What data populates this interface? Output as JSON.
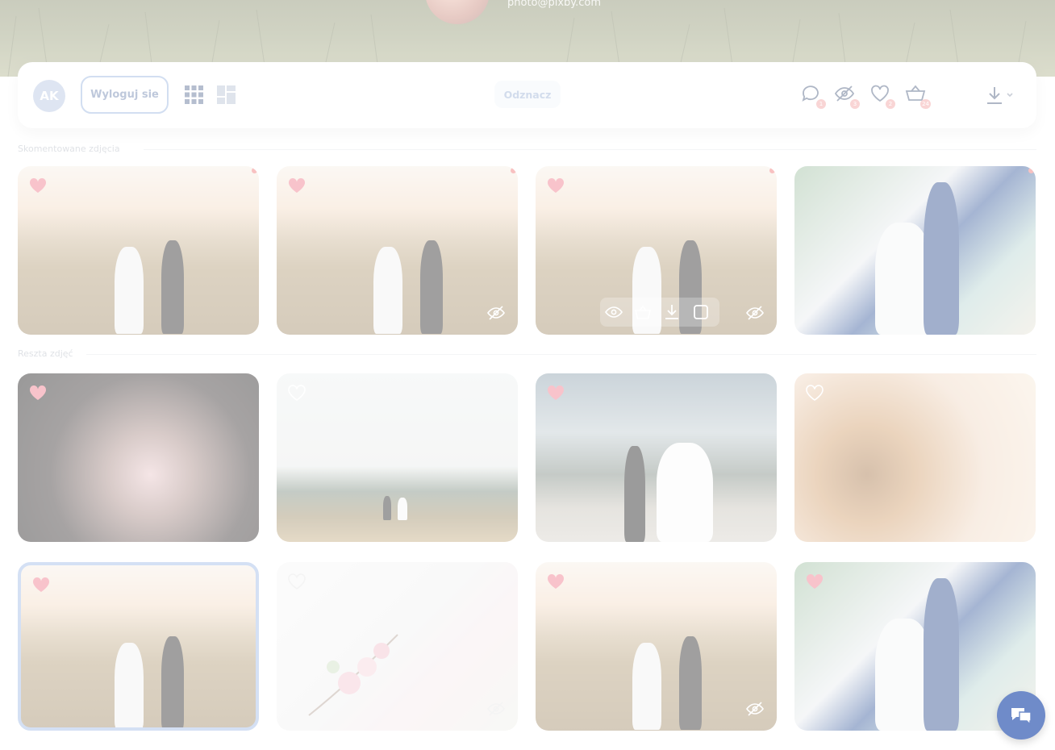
{
  "hero": {
    "photo_credit": "photo@pixby.com"
  },
  "toolbar": {
    "avatar_initials": "AK",
    "logout_label": "Wyloguj sie",
    "deselect_label": "Odznacz",
    "badges": {
      "comments": "1",
      "hidden": "3",
      "favorites": "2",
      "basket": "24"
    }
  },
  "sections": {
    "commented": "Skomentowane zdjęcia",
    "rest": "Reszta zdjęć"
  },
  "colors": {
    "accent": "#9bb7e0",
    "badge": "#f2a3a3",
    "heart_filled": "#f07a8c",
    "chat": "#6f8bc9"
  }
}
